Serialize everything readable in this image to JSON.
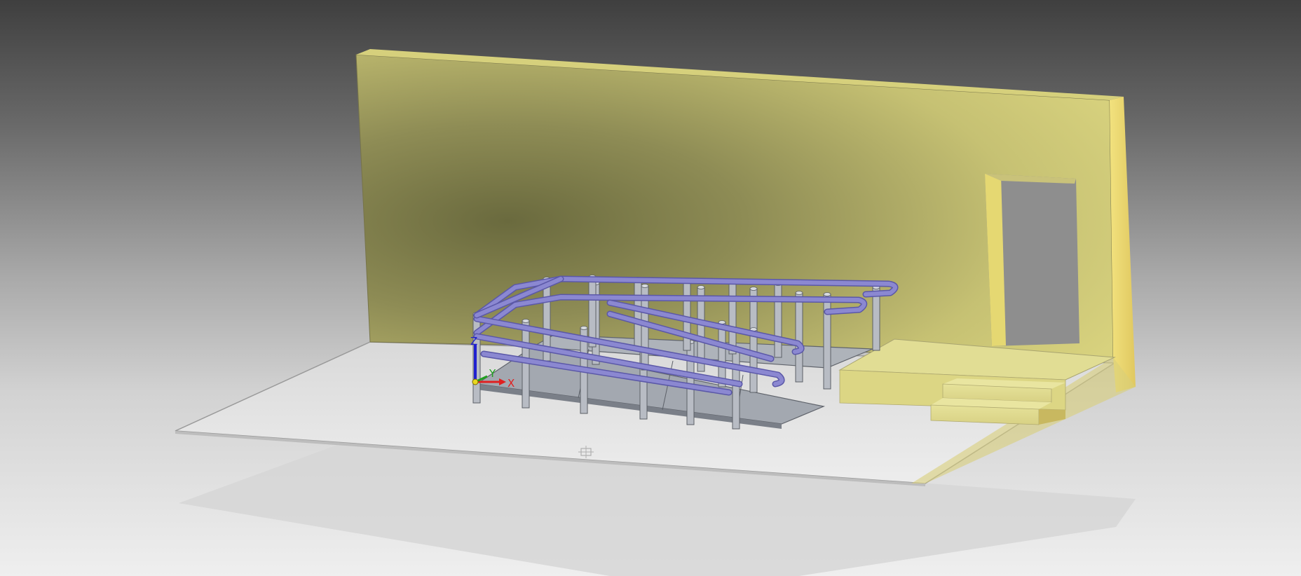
{
  "viewport": {
    "background_top": "#3f3f3f",
    "background_bottom": "#efefef"
  },
  "colors": {
    "wall_front": "#9c9a5c",
    "wall_light": "#d4d07a",
    "wall_edge": "#e9d776",
    "floor": "#e3e3e3",
    "shadow": "#d7d7d7",
    "landing": "#dedc8e",
    "rail": "#8b88d1",
    "rail_dark": "#5b58a8",
    "post": "#b8bcc4",
    "deck": "#9da2aa",
    "axis_x": "#e02020",
    "axis_y": "#20a020",
    "axis_z": "#2020d0"
  },
  "triad": {
    "x_label": "X",
    "y_label": "Y",
    "z_label": "Z"
  },
  "icons": {
    "origin_marker": "crosshair-icon"
  }
}
